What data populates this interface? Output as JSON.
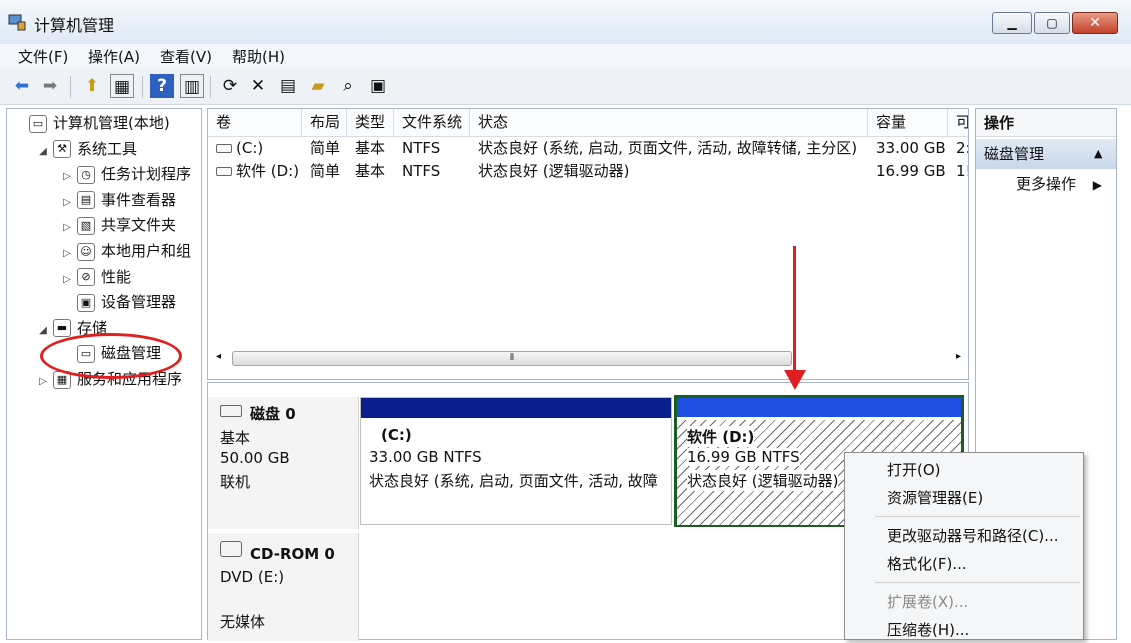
{
  "window": {
    "title": "计算机管理"
  },
  "menu": [
    "文件(F)",
    "操作(A)",
    "查看(V)",
    "帮助(H)"
  ],
  "toolbar_icons": [
    "back-icon",
    "forward-icon",
    "up-folder-icon",
    "show-hide-tree-icon",
    "help-icon",
    "show-hide-action-icon",
    "refresh-icon",
    "delete-icon",
    "properties-icon",
    "open-icon",
    "search-icon",
    "settings-icon"
  ],
  "tree": [
    {
      "label": "计算机管理(本地)",
      "level": 0,
      "exp": "",
      "icon": "computer-icon"
    },
    {
      "label": "系统工具",
      "level": 1,
      "exp": "◢",
      "icon": "tools-icon"
    },
    {
      "label": "任务计划程序",
      "level": 2,
      "exp": "▷",
      "icon": "clock-icon"
    },
    {
      "label": "事件查看器",
      "level": 2,
      "exp": "▷",
      "icon": "event-viewer-icon"
    },
    {
      "label": "共享文件夹",
      "level": 2,
      "exp": "▷",
      "icon": "shared-folder-icon"
    },
    {
      "label": "本地用户和组",
      "level": 2,
      "exp": "▷",
      "icon": "users-icon"
    },
    {
      "label": "性能",
      "level": 2,
      "exp": "▷",
      "icon": "performance-icon"
    },
    {
      "label": "设备管理器",
      "level": 2,
      "exp": "",
      "icon": "device-manager-icon"
    },
    {
      "label": "存储",
      "level": 1,
      "exp": "◢",
      "icon": "storage-icon"
    },
    {
      "label": "磁盘管理",
      "level": 2,
      "exp": "",
      "icon": "disk-management-icon"
    },
    {
      "label": "服务和应用程序",
      "level": 1,
      "exp": "▷",
      "icon": "services-icon"
    }
  ],
  "volumes": {
    "headers": [
      "卷",
      "布局",
      "类型",
      "文件系统",
      "状态",
      "容量",
      "可"
    ],
    "rows": [
      [
        "(C:)",
        "简单",
        "基本",
        "NTFS",
        "状态良好 (系统, 启动, 页面文件, 活动, 故障转储, 主分区)",
        "33.00 GB",
        "2:"
      ],
      [
        "软件 (D:)",
        "简单",
        "基本",
        "NTFS",
        "状态良好 (逻辑驱动器)",
        "16.99 GB",
        "1!"
      ]
    ]
  },
  "disk0": {
    "name": "磁盘 0",
    "type": "基本",
    "size": "50.00 GB",
    "status": "联机",
    "partitions": [
      {
        "name": "(C:)",
        "size": "33.00 GB NTFS",
        "status": "状态良好 (系统, 启动, 页面文件, 活动, 故障"
      },
      {
        "name": "软件  (D:)",
        "size": "16.99 GB NTFS",
        "status": "状态良好 (逻辑驱动器)"
      }
    ]
  },
  "cdrom": {
    "name": "CD-ROM 0",
    "type": "DVD (E:)",
    "status": "无媒体"
  },
  "actions": {
    "title": "操作",
    "section": "磁盘管理",
    "more": "更多操作"
  },
  "context_menu": [
    "打开(O)",
    "资源管理器(E)",
    "更改驱动器号和路径(C)...",
    "格式化(F)...",
    "扩展卷(X)...",
    "压缩卷(H)..."
  ],
  "colors": {
    "primary_partition": "#0a1f8c",
    "logical_partition": "#1f4fe0",
    "annotation": "#e02020"
  }
}
